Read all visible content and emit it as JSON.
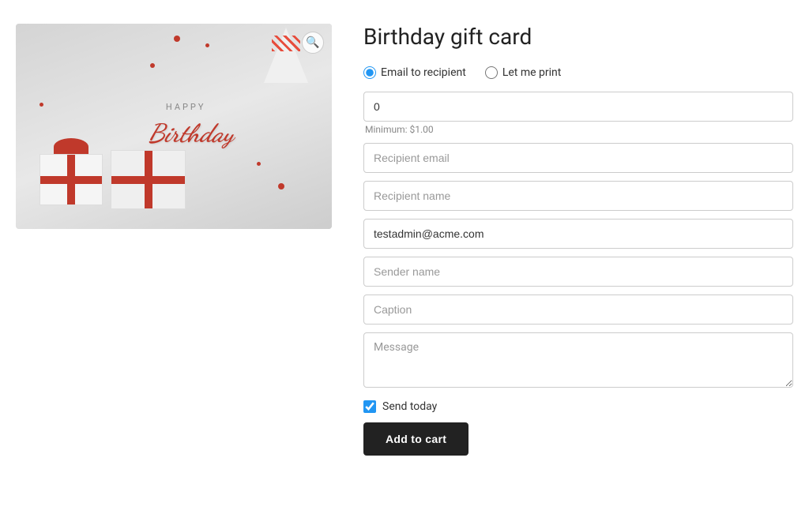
{
  "product": {
    "title": "Birthday gift card",
    "image_alt": "Birthday gift card image"
  },
  "delivery_options": {
    "email_to_recipient": {
      "label": "Email to recipient",
      "checked": true
    },
    "let_me_print": {
      "label": "Let me print",
      "checked": false
    }
  },
  "form": {
    "amount": {
      "value": "0",
      "placeholder": ""
    },
    "minimum_label": "Minimum: $1.00",
    "recipient_email": {
      "placeholder": "Recipient email",
      "value": ""
    },
    "recipient_name": {
      "placeholder": "Recipient name",
      "value": ""
    },
    "sender_email": {
      "placeholder": "",
      "value": "testadmin@acme.com"
    },
    "sender_name": {
      "placeholder": "Sender name",
      "value": ""
    },
    "caption": {
      "placeholder": "Caption",
      "value": ""
    },
    "message": {
      "placeholder": "Message",
      "value": ""
    },
    "send_today": {
      "label": "Send today",
      "checked": true
    },
    "add_to_cart_label": "Add to cart"
  },
  "zoom_icon": "🔍"
}
